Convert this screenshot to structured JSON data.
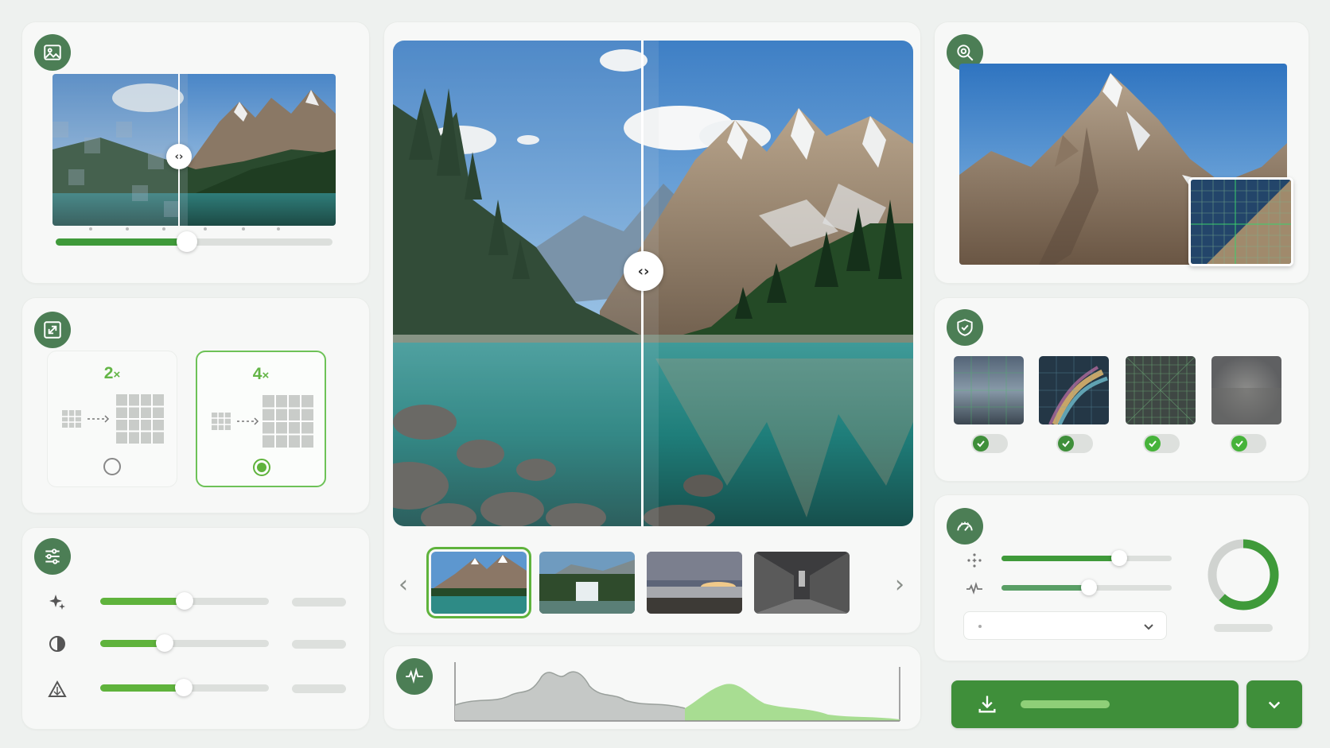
{
  "colors": {
    "accent": "#5fb33c",
    "dark_accent": "#4c7e55",
    "button": "#3f8f3a",
    "background": "#eef1ef"
  },
  "compare_preview": {
    "icon": "image-icon",
    "split_position": 0.48,
    "slider_value": 0.46
  },
  "upscale": {
    "icon": "resize-icon",
    "options": [
      {
        "factor": "2",
        "unit": "×",
        "selected": false
      },
      {
        "factor": "4",
        "unit": "×",
        "selected": true
      }
    ]
  },
  "adjustments": {
    "icon": "sliders-icon",
    "items": [
      {
        "icon": "sparkle-icon",
        "value": 0.5
      },
      {
        "icon": "contrast-icon",
        "value": 0.38
      },
      {
        "icon": "sharpen-icon",
        "value": 0.5
      }
    ]
  },
  "main_viewer": {
    "split_position": 0.51,
    "prev": "chevron-left-icon",
    "next": "chevron-right-icon",
    "thumbnails": [
      {
        "name": "mountain-lake",
        "selected": true
      },
      {
        "name": "waterfall",
        "selected": false
      },
      {
        "name": "sunset-beach",
        "selected": false
      },
      {
        "name": "city-street",
        "selected": false
      }
    ]
  },
  "histogram": {
    "icon": "waveform-icon"
  },
  "zoom": {
    "icon": "zoom-icon"
  },
  "artifacts": {
    "icon": "shield-icon",
    "filters": [
      {
        "name": "compression",
        "enabled": true
      },
      {
        "name": "chromatic-aberration",
        "enabled": true
      },
      {
        "name": "noise",
        "enabled": true
      },
      {
        "name": "blur",
        "enabled": true
      }
    ]
  },
  "performance": {
    "icon": "speedometer-icon",
    "sliders": [
      {
        "icon": "sparkle-dots-icon",
        "value": 0.7
      },
      {
        "icon": "waveform-small-icon",
        "value": 0.52
      }
    ],
    "dropdown_icon": "chevron-down-icon",
    "progress": 0.62
  },
  "export": {
    "download_icon": "download-icon",
    "menu_icon": "chevron-down-icon"
  }
}
